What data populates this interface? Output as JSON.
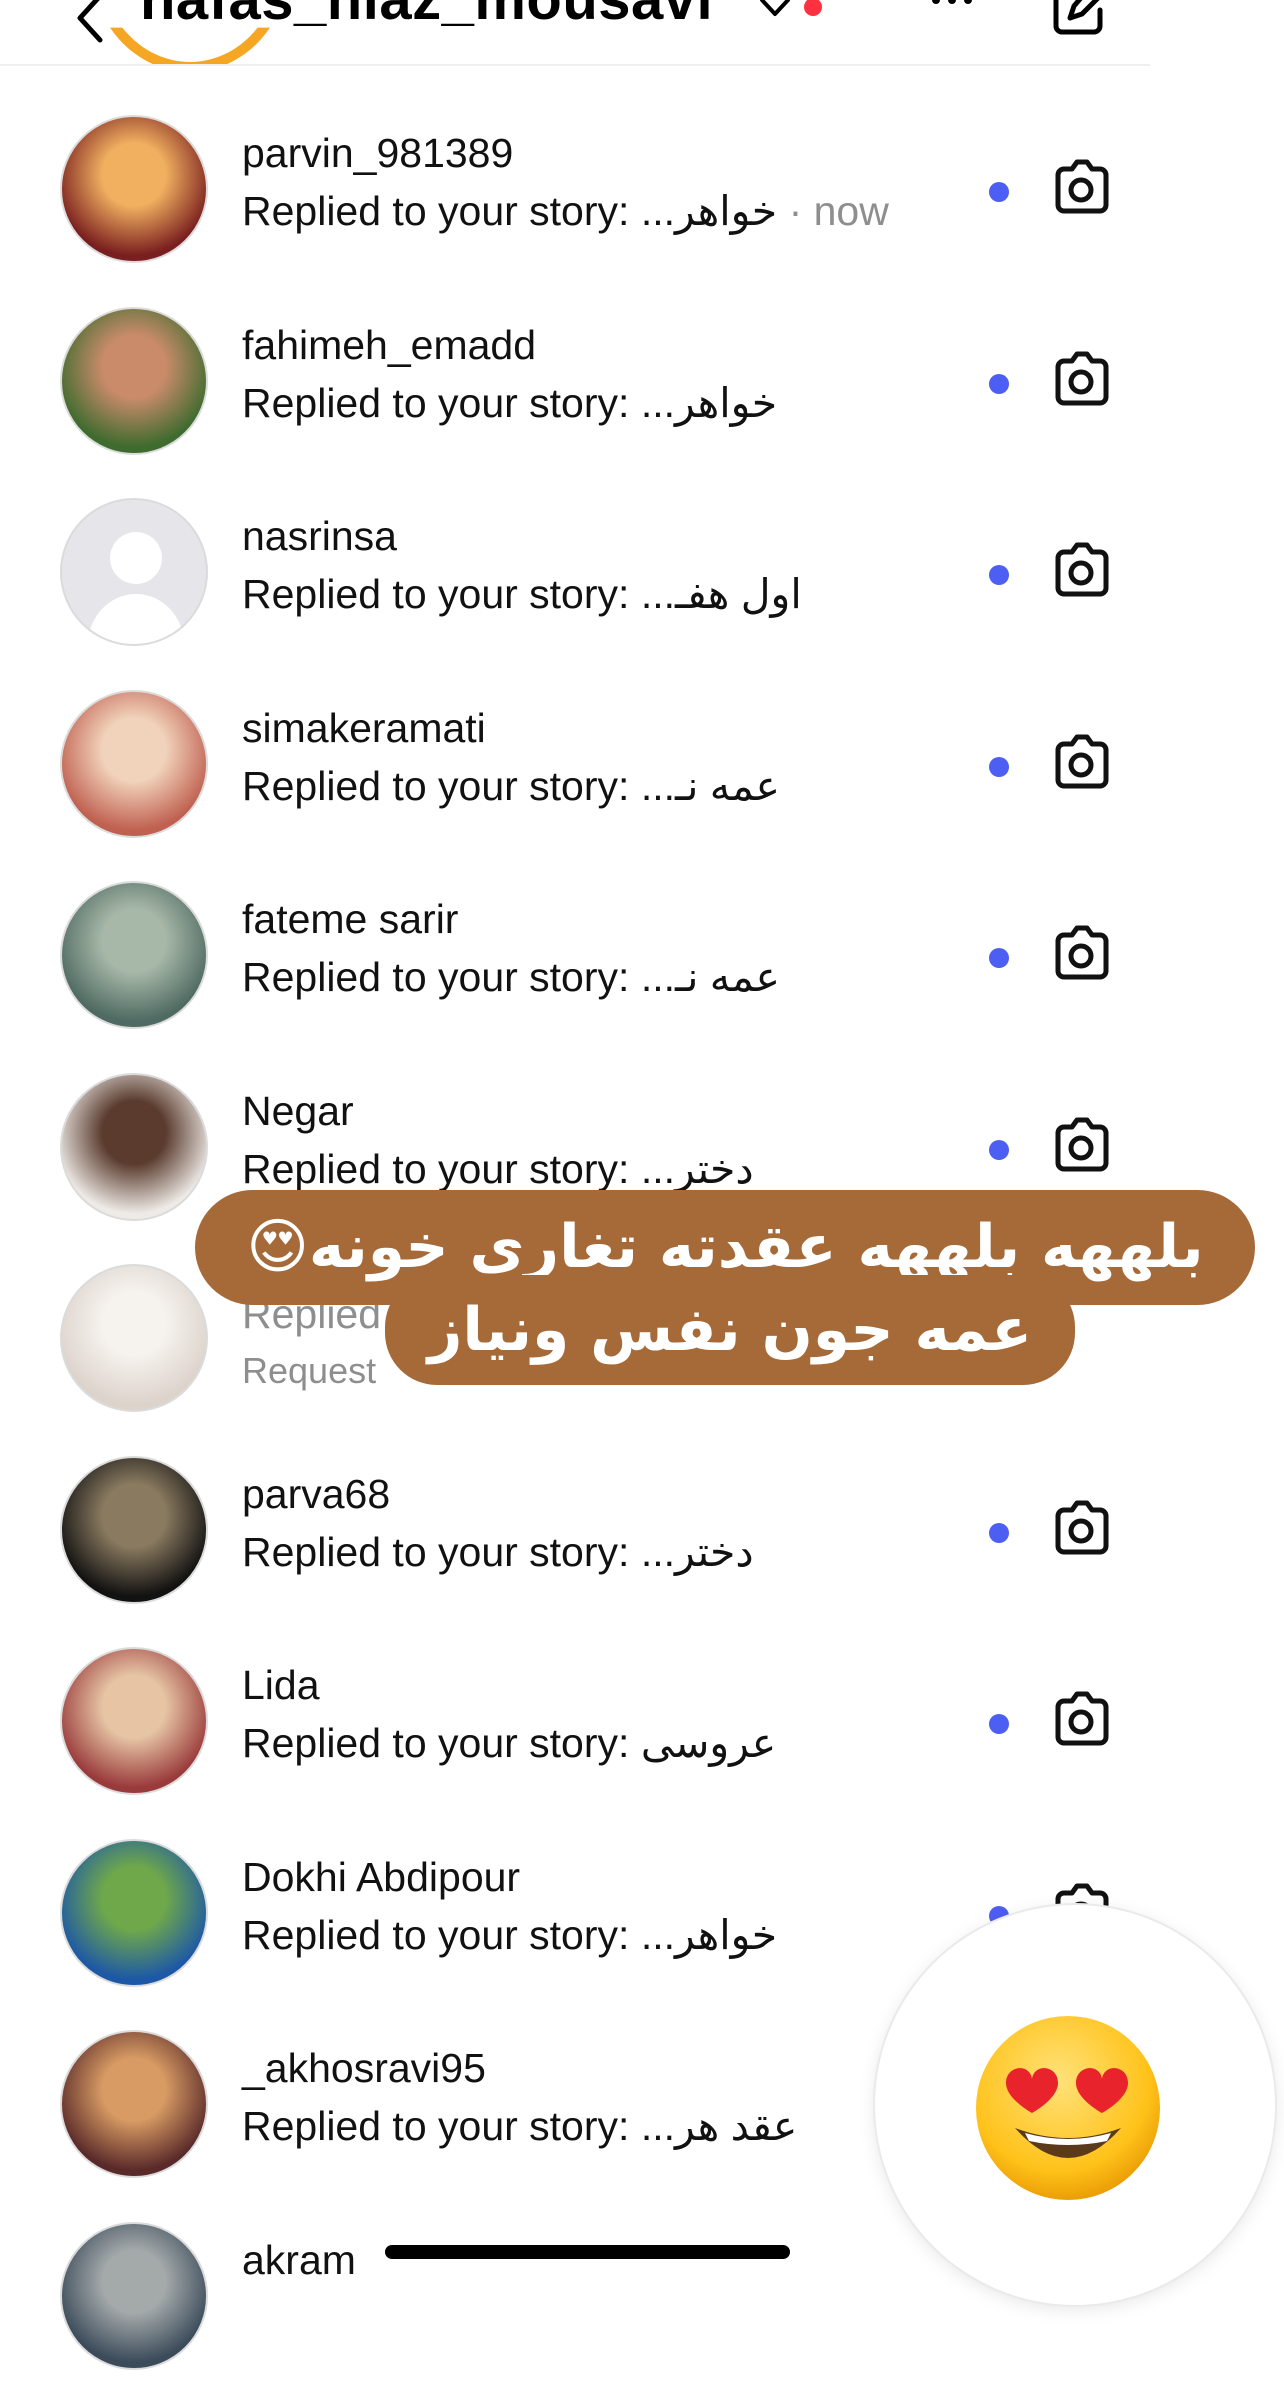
{
  "header": {
    "username": "nafas_niaz_mousavi"
  },
  "reply_prefix": "Replied to your story:",
  "threads": [
    {
      "username": "parvin_981389",
      "message": "خواهر...",
      "time": "· now",
      "avatar": [
        "#7a1f1f",
        "#f0b060"
      ],
      "unread": true
    },
    {
      "username": "fahimeh_emadd",
      "message": "خواهر...",
      "time": "",
      "avatar": [
        "#3e6b2e",
        "#c98b6a"
      ],
      "unread": true
    },
    {
      "username": "nasrinsa",
      "message": "اول هفـ...",
      "time": "",
      "avatar": [
        "#e6e6ea",
        "#ffffff"
      ],
      "unread": true,
      "placeholder": true
    },
    {
      "username": "simakeramati",
      "message": "عمه نـ...",
      "time": "",
      "avatar": [
        "#c06050",
        "#f1d3bb"
      ],
      "unread": true
    },
    {
      "username": "fateme sarir",
      "message": "عمه نـ...",
      "time": "",
      "avatar": [
        "#4f6a62",
        "#a7b8a8"
      ],
      "unread": true
    },
    {
      "username": "Negar",
      "message": "دختر...",
      "time": "",
      "avatar": [
        "#eeeae6",
        "#5a3b2e"
      ],
      "unread": true
    },
    {
      "username": "",
      "message": "",
      "time": "",
      "avatar": [
        "#dcd3cb",
        "#f6f2ee"
      ],
      "unread": false,
      "sub": "Request",
      "partial": "Replied"
    },
    {
      "username": "parva68",
      "message": "دختر...",
      "time": "",
      "avatar": [
        "#121212",
        "#8a7a60"
      ],
      "unread": true
    },
    {
      "username": "Lida",
      "message": "عروسی",
      "time": "",
      "avatar": [
        "#9a3b3b",
        "#e6c4a4"
      ],
      "unread": true
    },
    {
      "username": "Dokhi Abdipour",
      "message": "خواهر...",
      "time": "",
      "avatar": [
        "#1d58a6",
        "#6fa84a"
      ],
      "unread": true
    },
    {
      "username": "_akhosravi95",
      "message": "عقد هر...",
      "time": "",
      "avatar": [
        "#5a2a2a",
        "#d79b63"
      ],
      "unread": false
    },
    {
      "username": "akram",
      "message": "",
      "time": "",
      "avatar": [
        "#3b4b5a",
        "#a4a9aa"
      ],
      "unread": false
    }
  ],
  "caption": {
    "line1": "بلههه بلههه عقدته تغاری خونه😍",
    "line2": "عمه جون نفس ونیاز"
  },
  "reaction_emoji": "heart-eyes-emoji",
  "colors": {
    "unread_dot": "#4d5ef2",
    "notification_dot": "#ff3040",
    "caption_bg": "#a66a38",
    "secondary_text": "#8e8e8e"
  }
}
